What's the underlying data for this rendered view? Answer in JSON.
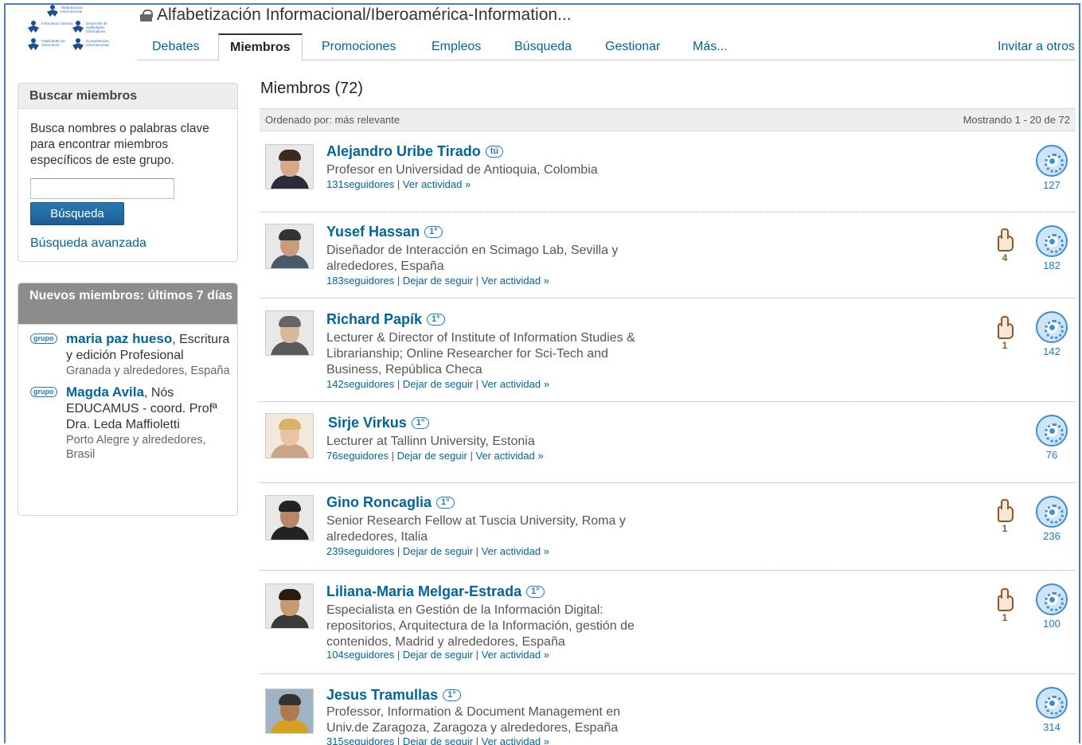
{
  "logo": {
    "cells": [
      {
        "label": "Alfabetización Informacional"
      },
      {
        "label": "Information Literacy"
      },
      {
        "label": "Desarrollo de Habilidades Informativas"
      },
      {
        "label": "Habilidades de Información"
      },
      {
        "label": "Competencias Informacionais"
      }
    ]
  },
  "group": {
    "title": "Alfabetización Informacional/Iberoamérica-Information..."
  },
  "tabs": [
    {
      "label": "Debates"
    },
    {
      "label": "Miembros"
    },
    {
      "label": "Promociones"
    },
    {
      "label": "Empleos"
    },
    {
      "label": "Búsqueda"
    },
    {
      "label": "Gestionar"
    },
    {
      "label": "Más..."
    }
  ],
  "invite_label": "Invitar a otros",
  "search_box": {
    "title": "Buscar miembros",
    "description": "Busca nombres o palabras clave para encontrar miembros específicos de este grupo.",
    "input_value": "",
    "button_label": "Búsqueda",
    "advanced_label": "Búsqueda avanzada"
  },
  "new_members": {
    "title": "Nuevos miembros: últimos 7 días",
    "badge": "grupo",
    "items": [
      {
        "name": "maria paz hueso",
        "rest": ", Escritura y edición Profesional",
        "location": "Granada y alrededores, España"
      },
      {
        "name": "Magda Avila",
        "rest": ", Nós EDUCAMUS - coord. Profª Dra. Leda Maffioletti",
        "location": "Porto Alegre y alrededores, Brasil"
      }
    ]
  },
  "main": {
    "title": "Miembros (72)",
    "sort_label": "Ordenado por: más relevante",
    "showing_label": "Mostrando 1 - 20 de 72"
  },
  "members": [
    {
      "name": "Alejandro Uribe Tirado",
      "badge": "tú",
      "headline": "Profesor en Universidad de Antioquia, Colombia",
      "followers": "131seguidores",
      "links": [
        "Ver actividad »"
      ],
      "likes": null,
      "network": "127"
    },
    {
      "name": "Yusef Hassan",
      "badge": "1°",
      "headline": "Diseñador de Interacción en Scimago Lab, Sevilla y alrededores, España",
      "followers": "183seguidores",
      "links": [
        "Dejar de seguir",
        "Ver actividad »"
      ],
      "likes": "4",
      "network": "182"
    },
    {
      "name": "Richard Papík",
      "badge": "1°",
      "headline": "Lecturer & Director of Institute of Information Studies & Librarianship; Online Researcher for Sci-Tech and Business, República Checa",
      "followers": "142seguidores",
      "links": [
        "Dejar de seguir",
        "Ver actividad »"
      ],
      "likes": "1",
      "network": "142"
    },
    {
      "name": "Sirje Virkus",
      "badge": "1°",
      "headline": "Lecturer at Tallinn University, Estonia",
      "followers": "76seguidores",
      "links": [
        "Dejar de seguir",
        "Ver actividad »"
      ],
      "likes": null,
      "network": "76"
    },
    {
      "name": "Gino Roncaglia",
      "badge": "1°",
      "headline": "Senior Research Fellow at Tuscia University, Roma y alrededores, Italia",
      "followers": "239seguidores",
      "links": [
        "Dejar de seguir",
        "Ver actividad »"
      ],
      "likes": "1",
      "network": "236"
    },
    {
      "name": "Liliana-Maria Melgar-Estrada",
      "badge": "1°",
      "headline": "Especialista en Gestión de la Información Digital: repositorios, Arquitectura de la Información, gestión de contenidos, Madrid y alrededores, España",
      "followers": "104seguidores",
      "links": [
        "Dejar de seguir",
        "Ver actividad »"
      ],
      "likes": "1",
      "network": "100"
    },
    {
      "name": "Jesus Tramullas",
      "badge": "1°",
      "headline": "Professor, Information & Document Management en Univ.de Zaragoza, Zaragoza y alrededores, España",
      "followers": "315seguidores",
      "links": [
        "Dejar de seguir",
        "Ver actividad »"
      ],
      "likes": null,
      "network": "314"
    }
  ],
  "colors": {
    "link": "#006699",
    "accent_blue": "#1f79c0",
    "button": "#1c5e93",
    "like_brown": "#8b5a2b",
    "window_border": "#4a7fc1"
  },
  "icons": {
    "lock": "lock-icon",
    "network": "network-icon",
    "like": "thumbs-up-icon",
    "avatar": "profile-photo"
  }
}
